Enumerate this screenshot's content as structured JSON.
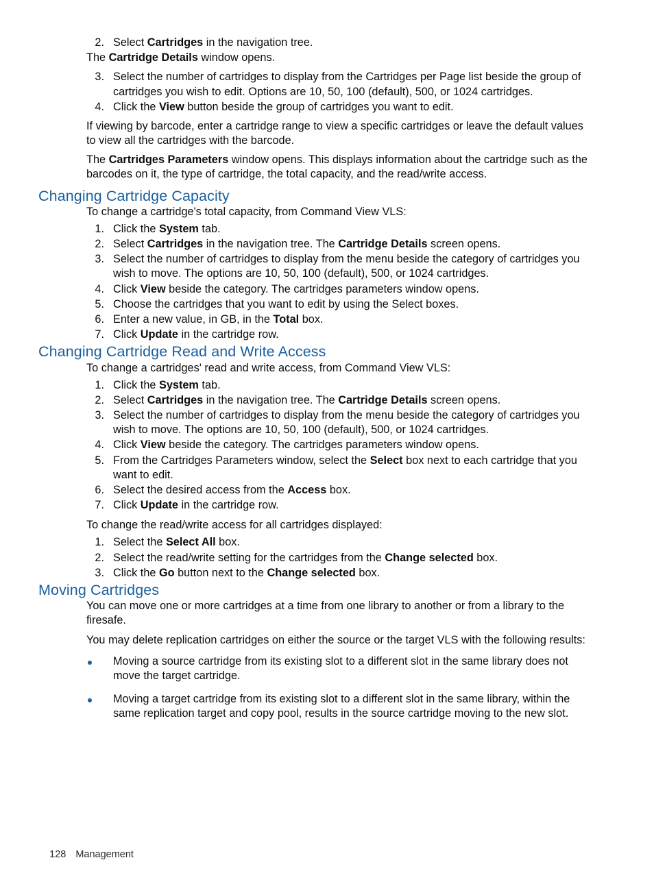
{
  "page": {
    "footer_page_number": "128",
    "footer_chapter": "Management",
    "heading_color": "#1a5f9e",
    "bullet_color": "#1a5f9e",
    "text_color": "#0d0d0d",
    "background_color": "#ffffff"
  },
  "intro_steps": {
    "items": [
      {
        "num": "2.",
        "parts": [
          {
            "t": "Select ",
            "b": false
          },
          {
            "t": "Cartridges",
            "b": true
          },
          {
            "t": " in the navigation tree.",
            "b": false
          }
        ]
      },
      {
        "num": "3.",
        "parts": [
          {
            "t": "Select the number of cartridges to display from the Cartridges per Page list beside the group of cartridges you wish to edit. Options are 10, 50, 100 (default), 500, or 1024 cartridges.",
            "b": false
          }
        ]
      },
      {
        "num": "4.",
        "parts": [
          {
            "t": "Click the ",
            "b": false
          },
          {
            "t": "View",
            "b": true
          },
          {
            "t": " button beside the group of cartridges you want to edit.",
            "b": false
          }
        ]
      }
    ],
    "after_step2_paragraph": [
      {
        "t": "The ",
        "b": false
      },
      {
        "t": "Cartridge Details",
        "b": true
      },
      {
        "t": " window opens.",
        "b": false
      }
    ],
    "after_step4_paragraph_1": [
      {
        "t": "If viewing by barcode, enter a cartridge range to view a specific cartridges or leave the default values to view all the cartridges with the barcode.",
        "b": false
      }
    ],
    "after_step4_paragraph_2": [
      {
        "t": "The ",
        "b": false
      },
      {
        "t": "Cartridges Parameters",
        "b": true
      },
      {
        "t": " window opens. This displays information about the cartridge such as the barcodes on it, the type of cartridge, the total capacity, and the read/write access.",
        "b": false
      }
    ]
  },
  "section_capacity": {
    "heading": "Changing Cartridge Capacity",
    "intro": [
      {
        "t": "To change a cartridge's total capacity, from Command View VLS:",
        "b": false
      }
    ],
    "steps": [
      {
        "num": "1.",
        "parts": [
          {
            "t": "Click the ",
            "b": false
          },
          {
            "t": "System",
            "b": true
          },
          {
            "t": " tab.",
            "b": false
          }
        ]
      },
      {
        "num": "2.",
        "parts": [
          {
            "t": "Select ",
            "b": false
          },
          {
            "t": "Cartridges",
            "b": true
          },
          {
            "t": " in the navigation tree. The ",
            "b": false
          },
          {
            "t": "Cartridge Details",
            "b": true
          },
          {
            "t": " screen opens.",
            "b": false
          }
        ]
      },
      {
        "num": "3.",
        "parts": [
          {
            "t": "Select the number of cartridges to display from the menu beside the category of cartridges you wish to move. The options are 10, 50, 100 (default), 500, or 1024 cartridges.",
            "b": false
          }
        ]
      },
      {
        "num": "4.",
        "parts": [
          {
            "t": "Click ",
            "b": false
          },
          {
            "t": "View",
            "b": true
          },
          {
            "t": " beside the category. The cartridges parameters window opens.",
            "b": false
          }
        ]
      },
      {
        "num": "5.",
        "parts": [
          {
            "t": "Choose the cartridges that you want to edit by using the Select boxes.",
            "b": false
          }
        ]
      },
      {
        "num": "6.",
        "parts": [
          {
            "t": "Enter a new value, in GB, in the ",
            "b": false
          },
          {
            "t": "Total",
            "b": true
          },
          {
            "t": " box.",
            "b": false
          }
        ]
      },
      {
        "num": "7.",
        "parts": [
          {
            "t": "Click ",
            "b": false
          },
          {
            "t": "Update",
            "b": true
          },
          {
            "t": " in the cartridge row.",
            "b": false
          }
        ]
      }
    ]
  },
  "section_access": {
    "heading": "Changing Cartridge Read and Write Access",
    "intro": [
      {
        "t": "To change a cartridges' read and write access, from Command View VLS:",
        "b": false
      }
    ],
    "steps": [
      {
        "num": "1.",
        "parts": [
          {
            "t": "Click the ",
            "b": false
          },
          {
            "t": "System",
            "b": true
          },
          {
            "t": " tab.",
            "b": false
          }
        ]
      },
      {
        "num": "2.",
        "parts": [
          {
            "t": "Select ",
            "b": false
          },
          {
            "t": "Cartridges",
            "b": true
          },
          {
            "t": " in the navigation tree. The ",
            "b": false
          },
          {
            "t": "Cartridge Details",
            "b": true
          },
          {
            "t": " screen opens.",
            "b": false
          }
        ]
      },
      {
        "num": "3.",
        "parts": [
          {
            "t": "Select the number of cartridges to display from the menu beside the category of cartridges you wish to move. The options are 10, 50, 100 (default), 500, or 1024 cartridges.",
            "b": false
          }
        ]
      },
      {
        "num": "4.",
        "parts": [
          {
            "t": "Click ",
            "b": false
          },
          {
            "t": "View",
            "b": true
          },
          {
            "t": " beside the category. The cartridges parameters window opens.",
            "b": false
          }
        ]
      },
      {
        "num": "5.",
        "parts": [
          {
            "t": "From the Cartridges Parameters window, select the ",
            "b": false
          },
          {
            "t": "Select",
            "b": true
          },
          {
            "t": " box next to each cartridge that you want to edit.",
            "b": false
          }
        ]
      },
      {
        "num": "6.",
        "parts": [
          {
            "t": "Select the desired access from the ",
            "b": false
          },
          {
            "t": "Access",
            "b": true
          },
          {
            "t": " box.",
            "b": false
          }
        ]
      },
      {
        "num": "7.",
        "parts": [
          {
            "t": "Click ",
            "b": false
          },
          {
            "t": "Update",
            "b": true
          },
          {
            "t": " in the cartridge row.",
            "b": false
          }
        ]
      }
    ],
    "all_intro": [
      {
        "t": "To change the read/write access for all cartridges displayed:",
        "b": false
      }
    ],
    "all_steps": [
      {
        "num": "1.",
        "parts": [
          {
            "t": "Select the ",
            "b": false
          },
          {
            "t": "Select All",
            "b": true
          },
          {
            "t": " box.",
            "b": false
          }
        ]
      },
      {
        "num": "2.",
        "parts": [
          {
            "t": "Select the read/write setting for the cartridges from the ",
            "b": false
          },
          {
            "t": "Change selected",
            "b": true
          },
          {
            "t": " box.",
            "b": false
          }
        ]
      },
      {
        "num": "3.",
        "parts": [
          {
            "t": "Click the ",
            "b": false
          },
          {
            "t": "Go",
            "b": true
          },
          {
            "t": " button next to the ",
            "b": false
          },
          {
            "t": "Change selected",
            "b": true
          },
          {
            "t": " box.",
            "b": false
          }
        ]
      }
    ]
  },
  "section_moving": {
    "heading": "Moving Cartridges",
    "paragraph_1": [
      {
        "t": "You can move one or more cartridges at a time from one library to another or from a library to the firesafe.",
        "b": false
      }
    ],
    "paragraph_2": [
      {
        "t": "You may delete replication cartridges on either the source or the target VLS with the following results:",
        "b": false
      }
    ],
    "bullets": [
      [
        {
          "t": "Moving a source cartridge from its existing slot to a different slot in the same library does not move the target cartridge.",
          "b": false
        }
      ],
      [
        {
          "t": "Moving a target cartridge from its existing slot to a different slot in the same library, within the same replication target and copy pool, results in the source cartridge moving to the new slot.",
          "b": false
        }
      ]
    ]
  }
}
